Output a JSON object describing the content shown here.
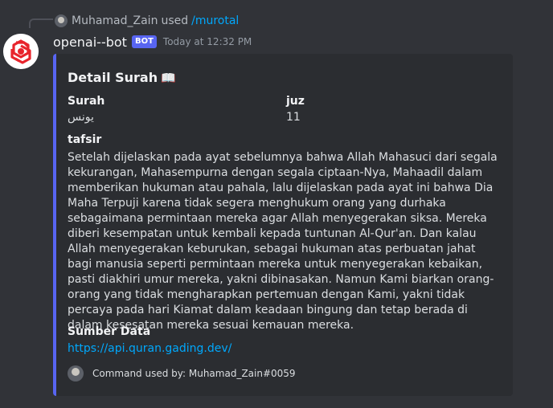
{
  "reply": {
    "username": "Muhamad_Zain",
    "action": "used",
    "command": "/murotal"
  },
  "message": {
    "author": "openai--bot",
    "badge": "BOT",
    "timestamp": "Today at 12:32 PM"
  },
  "embed": {
    "accent_color": "#5865f2",
    "title": "Detail Surah",
    "title_icon": "📖",
    "fields": {
      "surah_name": "Surah",
      "surah_value": "يونس",
      "juz_name": "juz",
      "juz_value": "11",
      "tafsir_name": "tafsir",
      "tafsir_value": "Setelah dijelaskan pada ayat sebelumnya bahwa Allah Mahasuci dari segala kekurangan, Mahasempurna dengan segala ciptaan-Nya, Mahaadil dalam memberikan hukuman atau pahala, lalu dijelaskan pada ayat ini bahwa Dia Maha Terpuji karena tidak segera menghukum orang yang durhaka sebagaimana permintaan mereka agar Allah menyegerakan siksa. Mereka diberi kesempatan untuk kembali kepada tuntunan Al-Qur'an. Dan kalau Allah menyegerakan keburukan, sebagai hukuman atas perbuatan jahat bagi manusia seperti permintaan mereka untuk menyegerakan kebaikan, pasti diakhiri umur mereka, yakni dibinasakan. Namun Kami biarkan orang-orang yang tidak mengharapkan pertemuan dengan Kami, yakni tidak percaya pada hari Kiamat dalam keadaan bingung dan tetap berada di dalam kesesatan mereka sesuai kemauan mereka.",
      "source_name": "Sumber Data",
      "source_link": "https://api.quran.gading.dev/"
    },
    "footer": "Command used by: Muhamad_Zain#0059"
  }
}
